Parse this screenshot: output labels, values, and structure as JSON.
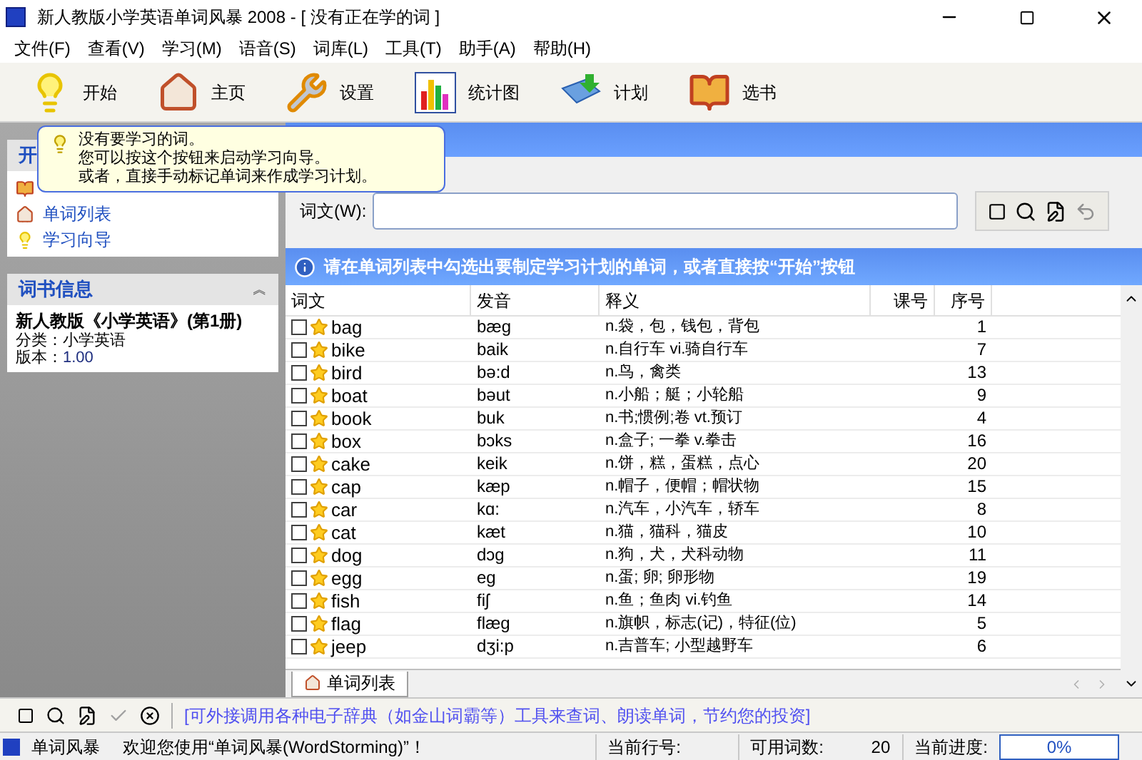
{
  "window": {
    "title": "新人教版小学英语单词风暴 2008 - [ 没有正在学的词 ]"
  },
  "menu": [
    "文件(F)",
    "查看(V)",
    "学习(M)",
    "语音(S)",
    "词库(L)",
    "工具(T)",
    "助手(A)",
    "帮助(H)"
  ],
  "toolbar": [
    {
      "kind": "bulb",
      "label": "开始"
    },
    {
      "kind": "home",
      "label": "主页"
    },
    {
      "kind": "wrench",
      "label": "设置"
    },
    {
      "kind": "chart",
      "label": "统计图"
    },
    {
      "kind": "plan",
      "label": "计划"
    },
    {
      "kind": "books",
      "label": "选书"
    }
  ],
  "tooltip": {
    "lines": [
      "没有要学习的词。",
      "您可以按这个按钮来启动学习向导。",
      "或者，直接手动标记单词来作成学习计划。"
    ]
  },
  "sidebar": {
    "title": "开",
    "items": [
      {
        "kind": "home",
        "label": "单词列表"
      },
      {
        "kind": "bulb",
        "label": "学习向导"
      }
    ]
  },
  "book_info": {
    "title": "词书信息",
    "collapse": "︽",
    "name": "新人教版《小学英语》(第1册)",
    "category": "分类：小学英语",
    "version_label": "版本：",
    "version": "1.00"
  },
  "search": {
    "label": "词文(W):"
  },
  "info_bar": "请在单词列表中勾选出要制定学习计划的单词，或者直接按“开始”按钮",
  "table": {
    "columns": [
      "词文",
      "发音",
      "释义",
      "课号",
      "序号"
    ],
    "rows": [
      {
        "word": "bag",
        "phonetic": "bæg",
        "meaning": "n.袋，包，钱包，背包",
        "index": "1",
        "checked": false
      },
      {
        "word": "bike",
        "phonetic": "baik",
        "meaning": "n.自行车 vi.骑自行车",
        "index": "7",
        "checked": false
      },
      {
        "word": "bird",
        "phonetic": "bə:d",
        "meaning": "n.鸟，禽类",
        "index": "13",
        "checked": false
      },
      {
        "word": "boat",
        "phonetic": "bəut",
        "meaning": "n.小船；艇；小轮船",
        "index": "9",
        "checked": false
      },
      {
        "word": "book",
        "phonetic": "buk",
        "meaning": "n.书;惯例;卷 vt.预订",
        "index": "4",
        "checked": false
      },
      {
        "word": "box",
        "phonetic": "bɔks",
        "meaning": "n.盒子; 一拳 v.拳击",
        "index": "16",
        "checked": false
      },
      {
        "word": "cake",
        "phonetic": "keik",
        "meaning": "n.饼，糕，蛋糕，点心",
        "index": "20",
        "checked": false
      },
      {
        "word": "cap",
        "phonetic": "kæp",
        "meaning": "n.帽子，便帽；帽状物",
        "index": "15",
        "checked": false
      },
      {
        "word": "car",
        "phonetic": "kɑ:",
        "meaning": "n.汽车，小汽车，轿车",
        "index": "8",
        "checked": false
      },
      {
        "word": "cat",
        "phonetic": "kæt",
        "meaning": "n.猫，猫科，猫皮",
        "index": "10",
        "checked": false
      },
      {
        "word": "dog",
        "phonetic": "dɔg",
        "meaning": "n.狗，犬，犬科动物",
        "index": "11",
        "checked": false
      },
      {
        "word": "egg",
        "phonetic": "eg",
        "meaning": "n.蛋; 卵; 卵形物",
        "index": "19",
        "checked": false
      },
      {
        "word": "fish",
        "phonetic": "fiʃ",
        "meaning": "n.鱼；鱼肉 vi.钓鱼",
        "index": "14",
        "checked": false
      },
      {
        "word": "flag",
        "phonetic": "flæg",
        "meaning": "n.旗帜，标志(记)，特征(位)",
        "index": "5",
        "checked": false
      },
      {
        "word": "jeep",
        "phonetic": "dʒi:p",
        "meaning": "n.吉普车; 小型越野车",
        "index": "6",
        "checked": false
      }
    ]
  },
  "bottom_tab": {
    "label": "单词列表",
    "selected": true
  },
  "bottom_toolbar": {
    "message": "[可外接调用各种电子辞典（如金山词霸等）工具来查词、朗读单词，节约您的投资]"
  },
  "status_bar": {
    "app": "单词风暴",
    "welcome": "欢迎您使用“单词风暴(WordStorming)”！",
    "row_label": "当前行号:",
    "count_label": "可用词数:",
    "count": "20",
    "progress_label": "当前进度:",
    "progress": "0%",
    "level": 0
  }
}
